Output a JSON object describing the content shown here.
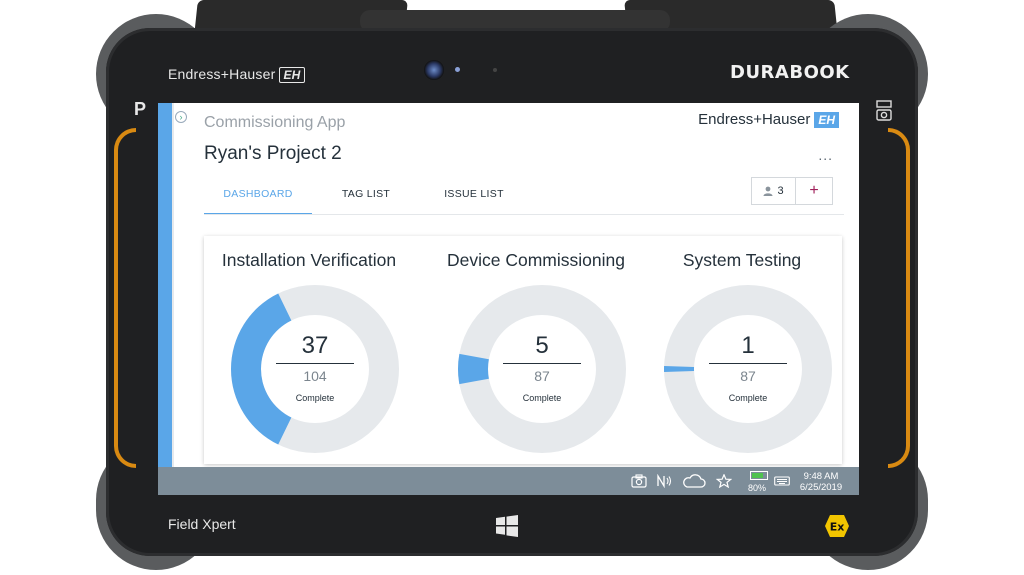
{
  "device": {
    "brand_top": "Endress+Hauser",
    "brand_mark": "EH",
    "manufacturer": "DURABOOK",
    "side_key": "P",
    "model": "Field Xpert"
  },
  "app": {
    "name": "Commissioning App",
    "brand": "Endress+Hauser",
    "brand_mark": "EH",
    "project_title": "Ryan's Project 2",
    "more_label": "...",
    "tabs": [
      {
        "label": "DASHBOARD",
        "active": true
      },
      {
        "label": "TAG LIST",
        "active": false
      },
      {
        "label": "ISSUE LIST",
        "active": false
      }
    ],
    "members_count": "3",
    "add_label": "+"
  },
  "dashboard": {
    "stats": [
      {
        "title": "Installation Verification",
        "complete": 37,
        "total": 104,
        "label": "Complete"
      },
      {
        "title": "Device Commissioning",
        "complete": 5,
        "total": 87,
        "label": "Complete"
      },
      {
        "title": "System Testing",
        "complete": 1,
        "total": 87,
        "label": "Complete"
      }
    ]
  },
  "taskbar": {
    "battery_percent": "80%",
    "battery_level": 0.8,
    "time": "9:48 AM",
    "date": "6/25/2019"
  },
  "colors": {
    "accent": "#5aa6e8",
    "donut_track": "#e6e9ec",
    "add_button": "#a0205a",
    "grip": "#d98a12",
    "taskbar": "#7d8d99"
  },
  "icons": [
    "camera-icon",
    "nfc-icon",
    "cloud-icon",
    "star-icon",
    "battery-icon",
    "keyboard-icon",
    "windows-icon",
    "ex-icon",
    "person-icon"
  ]
}
